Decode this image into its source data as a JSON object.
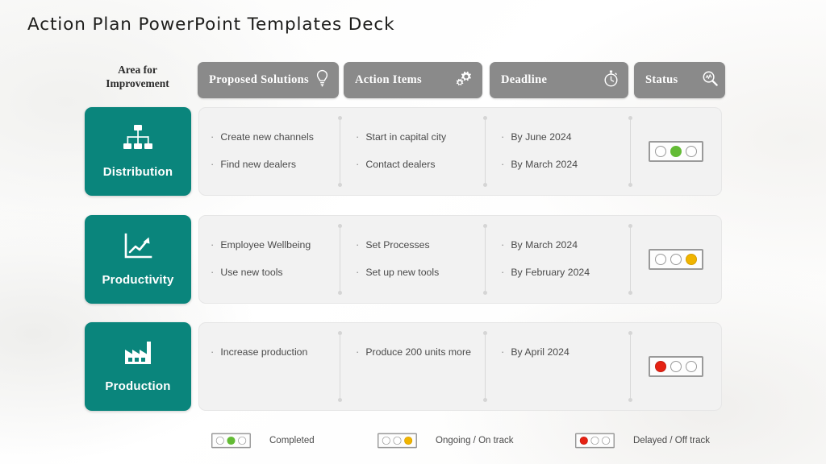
{
  "title": "Action Plan PowerPoint Templates Deck",
  "header": {
    "area_label_line1": "Area for",
    "area_label_line2": "Improvement",
    "tabs": [
      {
        "label": "Proposed Solutions",
        "icon": "lightbulb-icon"
      },
      {
        "label": "Action  Items",
        "icon": "gears-icon"
      },
      {
        "label": "Deadline",
        "icon": "stopwatch-icon"
      },
      {
        "label": "Status",
        "icon": "magnifier-chart-icon"
      }
    ],
    "tab_bg": "#8a8a8a",
    "tab_text_color": "#ffffff"
  },
  "rows": [
    {
      "category": "Distribution",
      "category_icon": "org-chart-icon",
      "category_color": "#0a857c",
      "proposed_solutions": [
        "Create new channels",
        "Find new dealers"
      ],
      "action_items": [
        "Start in  capital  city",
        "Contact dealers"
      ],
      "deadlines": [
        "By June 2024",
        "By March 2024"
      ],
      "status": {
        "state": "completed",
        "lamp_index": 1,
        "color": "#63bb35"
      }
    },
    {
      "category": "Productivity",
      "category_icon": "growth-chart-icon",
      "category_color": "#0a857c",
      "proposed_solutions": [
        "Employee Wellbeing",
        "Use new tools"
      ],
      "action_items": [
        "Set Processes",
        "Set up new tools"
      ],
      "deadlines": [
        "By March 2024",
        "By February 2024"
      ],
      "status": {
        "state": "ongoing",
        "lamp_index": 2,
        "color": "#f0b400"
      }
    },
    {
      "category": "Production",
      "category_icon": "factory-icon",
      "category_color": "#0a857c",
      "proposed_solutions": [
        "Increase production"
      ],
      "action_items": [
        "Produce 200 units more"
      ],
      "deadlines": [
        "By April 2024"
      ],
      "status": {
        "state": "delayed",
        "lamp_index": 0,
        "color": "#e52213"
      }
    }
  ],
  "legend": [
    {
      "label": "Completed",
      "lamp_index": 1,
      "color": "#63bb35"
    },
    {
      "label": "Ongoing / On track",
      "lamp_index": 2,
      "color": "#f0b400"
    },
    {
      "label": "Delayed / Off track",
      "lamp_index": 0,
      "color": "#e52213"
    }
  ]
}
